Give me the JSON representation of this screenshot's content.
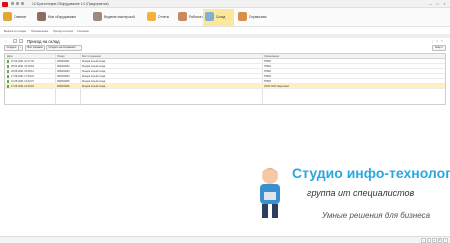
{
  "window": {
    "title": "1С:Бухгалтерия-Оборудование 1.0 (Предприятие)",
    "controls": [
      "—",
      "□",
      "×"
    ]
  },
  "sections": [
    {
      "label": "Главное",
      "color": "#e0a63a"
    },
    {
      "label": "Мое оборудование",
      "color": "#8d6e63"
    },
    {
      "label": "Ведение мастерской",
      "color": "#a1887f"
    },
    {
      "label": "Отчеты",
      "color": "#f2b33d"
    },
    {
      "label": "Рабочее место",
      "color": "#c98b5e"
    },
    {
      "label": "Склад",
      "color": "#7fb0d6",
      "active": true
    },
    {
      "label": "Справочник",
      "color": "#d98f4c"
    }
  ],
  "subnav": [
    "Выдача со склада",
    "Перемещение",
    "Приход на склад",
    "Списание"
  ],
  "form": {
    "title": "Приход на склад",
    "win_controls": [
      "⋮",
      "□",
      "×"
    ]
  },
  "toolbar": {
    "create": "Создать",
    "find": "Все приемки",
    "search_placeholder": "Создать на основании",
    "more": "Еще ▾"
  },
  "table": {
    "columns": [
      "Дата",
      "Номер",
      "Место хранения",
      "Организация"
    ],
    "rows": [
      {
        "date": "27.04.2021 10:17:34",
        "number": "000000001",
        "place": "Резерв пятый склад",
        "org": "НПКИ"
      },
      {
        "date": "28.04.2021 10:18:18",
        "number": "000000002",
        "place": "Резерв пятый склад",
        "org": "НПКИ"
      },
      {
        "date": "03.05.2021 15:38:12",
        "number": "000000003",
        "place": "Резерв пятый склад",
        "org": "НПКИ"
      },
      {
        "date": "17.05.2021 17:30:22",
        "number": "000000004",
        "place": "Резерв пятый склад",
        "org": "НПКИ"
      },
      {
        "date": "21.05.2021 12:32:07",
        "number": "000000005",
        "place": "Резерв пятый склад",
        "org": "НПКИ"
      },
      {
        "date": "17.06.2021 12:43:18",
        "number": "000000006",
        "place": "Резерв пятый склад",
        "org": "ООО ООО Энергомет",
        "selected": true
      }
    ]
  },
  "brand": {
    "title": "Студио инфо-технологии",
    "subtitle": "группа ит специалистов",
    "tagline": "Умные решения для бизнеса"
  },
  "statusbar": [
    "‹",
    "›",
    "≡",
    "⟳",
    "i"
  ]
}
